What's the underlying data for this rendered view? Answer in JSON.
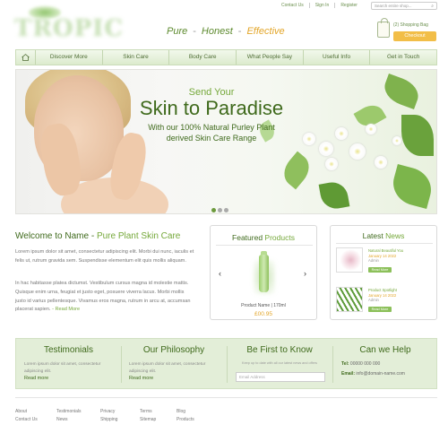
{
  "header": {
    "top_links": [
      "Contact Us",
      "Sign In",
      "Register"
    ],
    "search_placeholder": "Search entire shop...",
    "logo_text": "TROPIC",
    "tagline": {
      "pure": "Pure",
      "honest": "Honest",
      "effective": "Effective",
      "sep": "-"
    },
    "cart": {
      "label": "(2) Shopping Bag",
      "checkout": "Checkout"
    }
  },
  "nav": {
    "items": [
      "Discover More",
      "Skin Care",
      "Body Care",
      "What People Say",
      "Useful Info",
      "Get in Touch"
    ]
  },
  "hero": {
    "line1": "Send Your",
    "line2": "Skin to Paradise",
    "line3a": "With our 100% Natural Purley Plant",
    "line3b": "derived Skin Care Range"
  },
  "welcome": {
    "title_a": "Welcome to Name - ",
    "title_b": "Pure Plant Skin Care",
    "p1": "Lorem ipsum dolor sit amet, consectetur adipiscing elit. Morbi dui nunc, iaculis et felis ut, rutrum gravida sem. Suspendisse elementum elit quis mollis aliquam.",
    "p2": "In hac habitasse platea dictumst. Vestibulum cursus magna id molestie mattis. Quisque enim urna, feugiat et justo eget, posuere viverra lacus. Morbi mollis justo id varius pellentesque. Vivamus eros magna, rutrum in arcu at, accumsan placerat sapien.",
    "read_more": "- Read More"
  },
  "featured": {
    "title_a": "Featured ",
    "title_b": "Products",
    "product_name": "Product Name | 170ml",
    "price": "£00.95"
  },
  "news": {
    "title_a": "Latest ",
    "title_b": "News",
    "items": [
      {
        "title": "Natural Beautiful You",
        "date": "January 14 2022",
        "author": "Admin",
        "button": "Read More"
      },
      {
        "title": "Product Spotlight",
        "date": "January 14 2022",
        "author": "Admin",
        "button": "Read More"
      }
    ]
  },
  "band": {
    "testimonials": {
      "title": "Testimonials",
      "text": "Lorem ipsum dolor sit amet, consectetur adipiscing elit.",
      "more": "Read more"
    },
    "philosophy": {
      "title": "Our Philosophy",
      "text": "Lorem ipsum dolor sit amet, consectetur adipiscing elit.",
      "more": "Read more"
    },
    "know": {
      "title": "Be First to Know",
      "text": "Keep up to date with all our latest news and offers",
      "placeholder": "Email Address"
    },
    "help": {
      "title": "Can we Help",
      "tel_label": "Tel:",
      "tel": "00000 000 000",
      "email_label": "Email:",
      "email": "info@domain-name.com"
    }
  },
  "footer": {
    "columns": [
      [
        "About",
        "Contact Us"
      ],
      [
        "Testimonials",
        "News"
      ],
      [
        "Privacy",
        "Shipping"
      ],
      [
        "Terms",
        "Sitemap"
      ],
      [
        "Blog",
        "Products"
      ]
    ]
  },
  "colors": {
    "brand_green": "#3f6a1c",
    "accent_green": "#75a83a",
    "accent_orange": "#e3a62a",
    "checkout_yellow": "#f2be48",
    "band_bg": "#e3eed8"
  },
  "icons": [
    "home-icon",
    "search-icon",
    "shopping-bag-icon",
    "arrow-left-icon",
    "arrow-right-icon"
  ]
}
